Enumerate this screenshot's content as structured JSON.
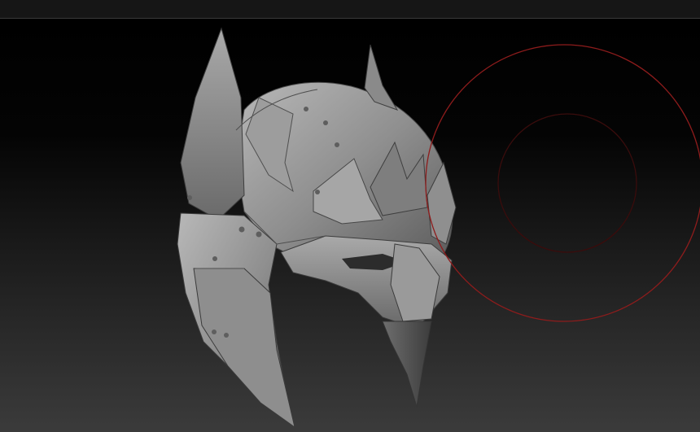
{
  "viewport": {
    "model": "helmet-sculpt",
    "background": "gradient-black-to-gray",
    "brush_cursor": {
      "shape": "double-circle",
      "color": "#9a1a1a"
    },
    "model_color": "#8c8c8c"
  }
}
